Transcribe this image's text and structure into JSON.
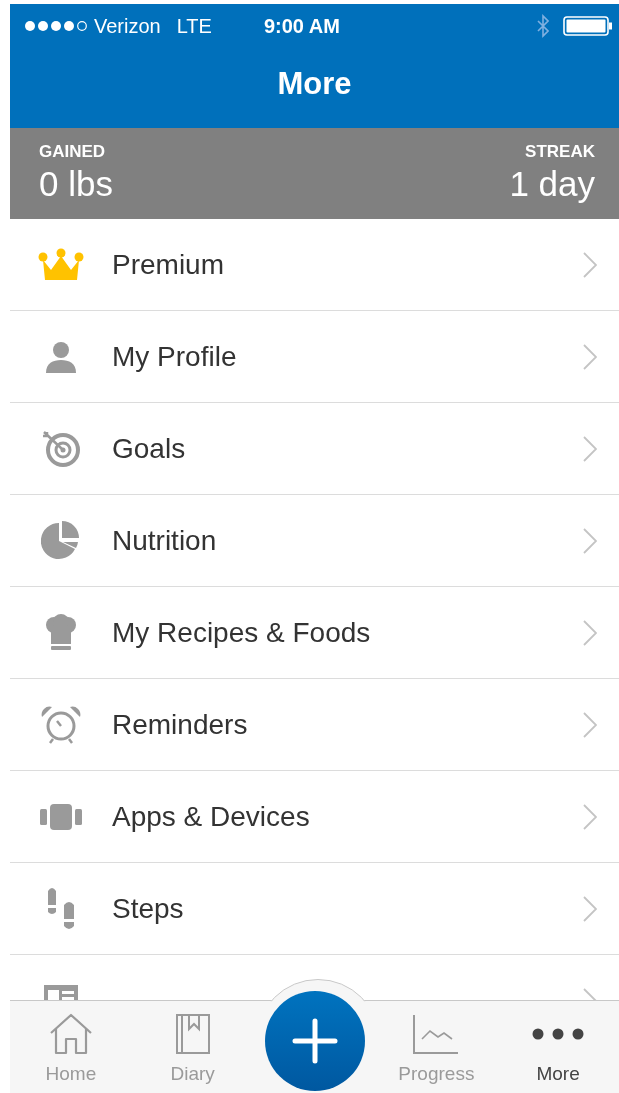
{
  "status_bar": {
    "carrier": "Verizon",
    "network": "LTE",
    "time": "9:00 AM"
  },
  "nav": {
    "title": "More"
  },
  "stats": [
    {
      "label": "GAINED",
      "value": "0 lbs"
    },
    {
      "label": "STREAK",
      "value": "1 day"
    }
  ],
  "menu": [
    {
      "label": "Premium",
      "kind": "crown"
    },
    {
      "label": "My Profile",
      "kind": "person"
    },
    {
      "label": "Goals",
      "kind": "target"
    },
    {
      "label": "Nutrition",
      "kind": "pie"
    },
    {
      "label": "My Recipes & Foods",
      "kind": "chef"
    },
    {
      "label": "Reminders",
      "kind": "alarm"
    },
    {
      "label": "Apps & Devices",
      "kind": "band"
    },
    {
      "label": "Steps",
      "kind": "steps"
    },
    {
      "kind": "blog",
      "cut_off": true
    }
  ],
  "tabs": [
    {
      "label": "Home",
      "kind": "home",
      "selected": false
    },
    {
      "label": "Diary",
      "kind": "diary",
      "selected": false
    },
    {
      "label": "Progress",
      "kind": "progress",
      "selected": false
    },
    {
      "label": "More",
      "kind": "more",
      "selected": true
    }
  ]
}
